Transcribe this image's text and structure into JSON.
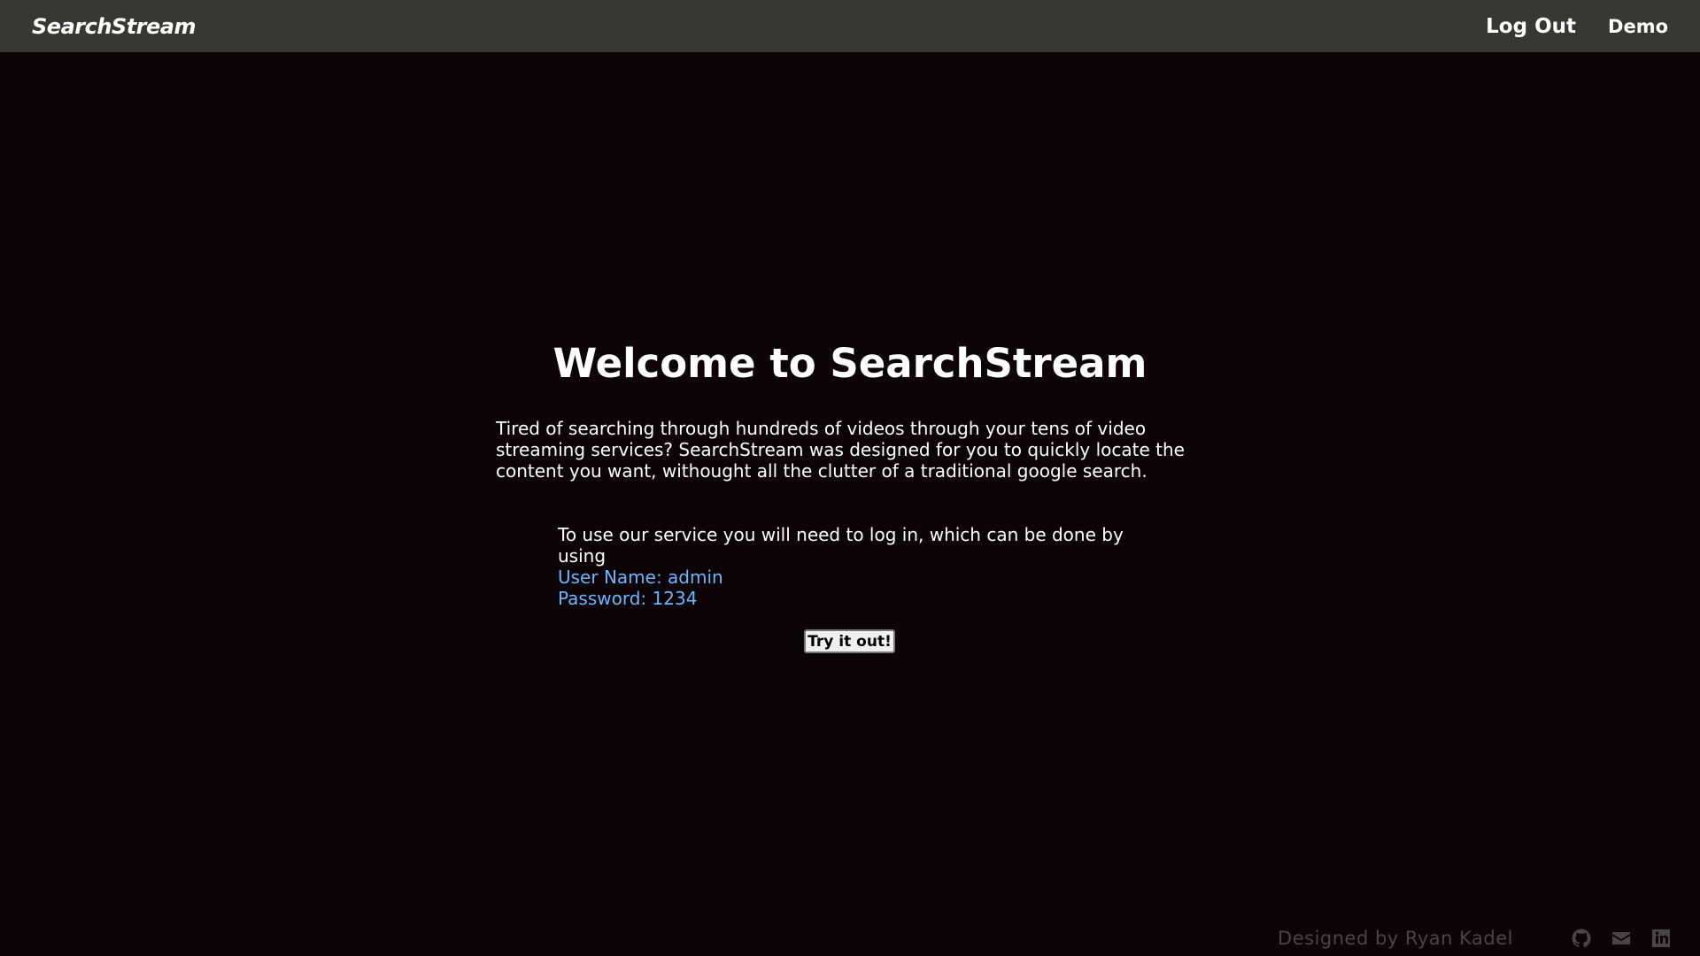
{
  "navbar": {
    "brand": "SearchStream",
    "links": [
      {
        "label": "Log Out"
      },
      {
        "label": "Demo"
      }
    ]
  },
  "main": {
    "title": "Welcome to SearchStream",
    "intro": "Tired of searching through hundreds of videos through your tens of video streaming services? SearchStream was designed for you to quickly locate the content you want, withought all the clutter of a traditional google search.",
    "login_text": "To use our service you will need to log in, which can be done by using",
    "username_line": "User Name: admin",
    "password_line": "Password: 1234",
    "try_button": "Try it out!"
  },
  "footer": {
    "designed_by": "Designed by Ryan Kadel",
    "icons": [
      "github-icon",
      "email-icon",
      "linkedin-icon"
    ]
  },
  "colors": {
    "background": "#0c0406",
    "navbar": "#373836",
    "credentials": "#6bb6ff",
    "footer_text": "#4b4446"
  }
}
